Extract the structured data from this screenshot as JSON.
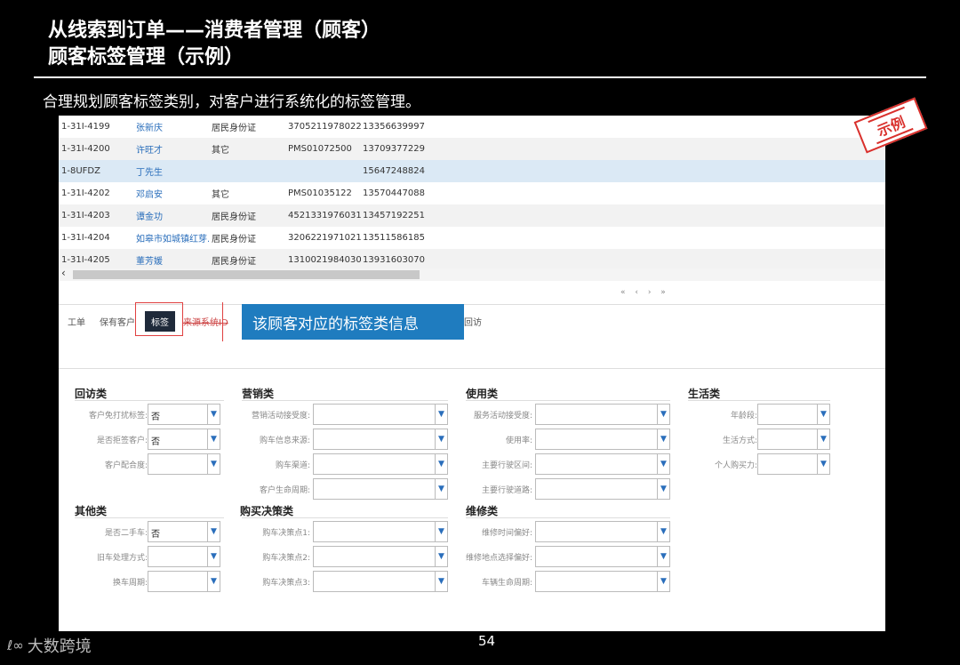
{
  "title": {
    "line1": "从线索到订单——消费者管理（顾客）",
    "line2": "顾客标签管理（示例）"
  },
  "subtitle": "合理规划顾客标签类别，对客户进行系统化的标签管理。",
  "stamp": "示例",
  "table": {
    "rows": [
      {
        "id": "1-31I-4199",
        "name": "张新庆",
        "type": "居民身份证",
        "doc": "370521197802251...",
        "phone": "13356639997"
      },
      {
        "id": "1-31I-4200",
        "name": "许旺才",
        "type": "其它",
        "doc": "PMS01072500",
        "phone": "13709377229"
      },
      {
        "id": "1-8UFDZ",
        "name": "丁先生",
        "type": "",
        "doc": "",
        "phone": "15647248824"
      },
      {
        "id": "1-31I-4202",
        "name": "邓启安",
        "type": "其它",
        "doc": "PMS01035122",
        "phone": "13570447088"
      },
      {
        "id": "1-31I-4203",
        "name": "谭金功",
        "type": "居民身份证",
        "doc": "452133197603180...",
        "phone": "13457192251"
      },
      {
        "id": "1-31I-4204",
        "name": "如皋市如城镇红芽...",
        "type": "居民身份证",
        "doc": "320622197102177...",
        "phone": "13511586185"
      },
      {
        "id": "1-31I-4205",
        "name": "董芳媛",
        "type": "居民身份证",
        "doc": "131002198403073...",
        "phone": "13931603070"
      }
    ]
  },
  "scroll_arrow": "‹",
  "pager": "« ‹ › »",
  "tabs": {
    "t1": "工单",
    "t2": "保有客户",
    "t3": "标签",
    "t4": "来源系统ID",
    "t5": "回访"
  },
  "callout": "该顾客对应的标签类信息",
  "groups": {
    "huifang": {
      "title": "回访类",
      "f1_label": "客户免打扰标签:",
      "f1_value": "否",
      "f2_label": "是否拒签客户:",
      "f2_value": "否",
      "f3_label": "客户配合度:",
      "f3_value": ""
    },
    "yingxiao": {
      "title": "营销类",
      "f1_label": "营销活动接受度:",
      "f2_label": "购车信息来源:",
      "f3_label": "购车渠道:",
      "f4_label": "客户生命周期:"
    },
    "shiyong": {
      "title": "使用类",
      "f1_label": "服务活动接受度:",
      "f2_label": "使用率:",
      "f3_label": "主要行驶区间:",
      "f4_label": "主要行驶道路:"
    },
    "shenghuo": {
      "title": "生活类",
      "f1_label": "年龄段:",
      "f2_label": "生活方式:",
      "f3_label": "个人购买力:"
    },
    "qita": {
      "title": "其他类",
      "f1_label": "是否二手车:",
      "f1_value": "否",
      "f2_label": "旧车处理方式:",
      "f3_label": "换车周期:"
    },
    "goumai": {
      "title": "购买决策类",
      "f1_label": "购车决策点1:",
      "f2_label": "购车决策点2:",
      "f3_label": "购车决策点3:"
    },
    "weixiu": {
      "title": "维修类",
      "f1_label": "维修时间偏好:",
      "f2_label": "维修地点选择偏好:",
      "f3_label": "车辆生命周期:"
    }
  },
  "page_number": "54",
  "logo": {
    "mark": "ℓ∞",
    "text": "大数跨境"
  },
  "icons": {
    "dropdown": "chevron-down-icon"
  },
  "colors": {
    "accent": "#1f7cbf",
    "link": "#2a6ebb",
    "highlight": "#e04040"
  }
}
